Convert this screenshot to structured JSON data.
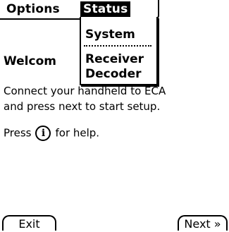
{
  "menubar": {
    "menus": [
      {
        "label": "Options"
      },
      {
        "label": "Status"
      }
    ]
  },
  "dropdown": {
    "items": [
      {
        "label": "System"
      },
      {
        "label": "Receiver"
      },
      {
        "label": "Decoder"
      }
    ]
  },
  "body": {
    "welcome_visible": "Welcom",
    "line1": "Connect your handheld to ECA",
    "line2": "and press next to start setup.",
    "help_prefix": "Press",
    "help_icon_glyph": "i",
    "help_suffix": "for help."
  },
  "buttons": {
    "exit": "Exit",
    "next": "Next »"
  }
}
